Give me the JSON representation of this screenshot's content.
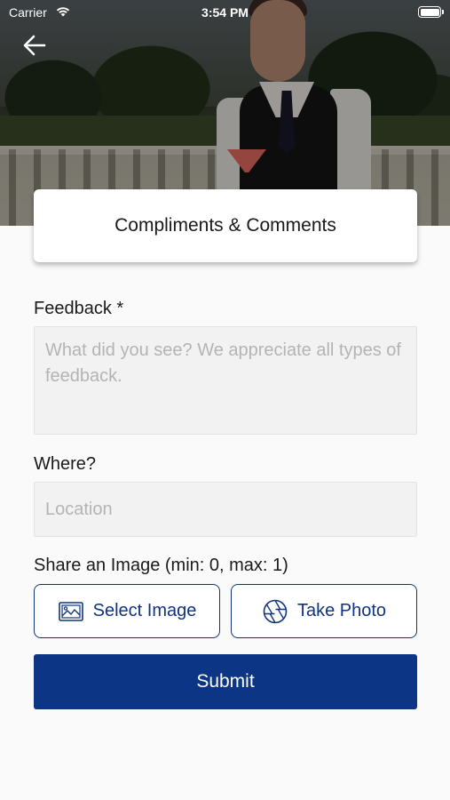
{
  "status_bar": {
    "carrier": "Carrier",
    "time": "3:54 PM"
  },
  "header": {
    "back_icon": "arrow-left-icon",
    "title": "Compliments & Comments"
  },
  "form": {
    "feedback": {
      "label": "Feedback *",
      "placeholder": "What did you see? We appreciate all types of feedback.",
      "value": ""
    },
    "where": {
      "label": "Where?",
      "placeholder": "Location",
      "value": ""
    },
    "share_image": {
      "label": "Share an Image (min: 0, max: 1)",
      "select_label": "Select Image",
      "select_icon": "image-icon",
      "photo_label": "Take Photo",
      "photo_icon": "camera-aperture-icon"
    },
    "submit_label": "Submit"
  },
  "colors": {
    "primary": "#0d3585",
    "outline": "#0f3380",
    "field_bg": "#f2f2f2",
    "placeholder": "#b4b4b4"
  }
}
